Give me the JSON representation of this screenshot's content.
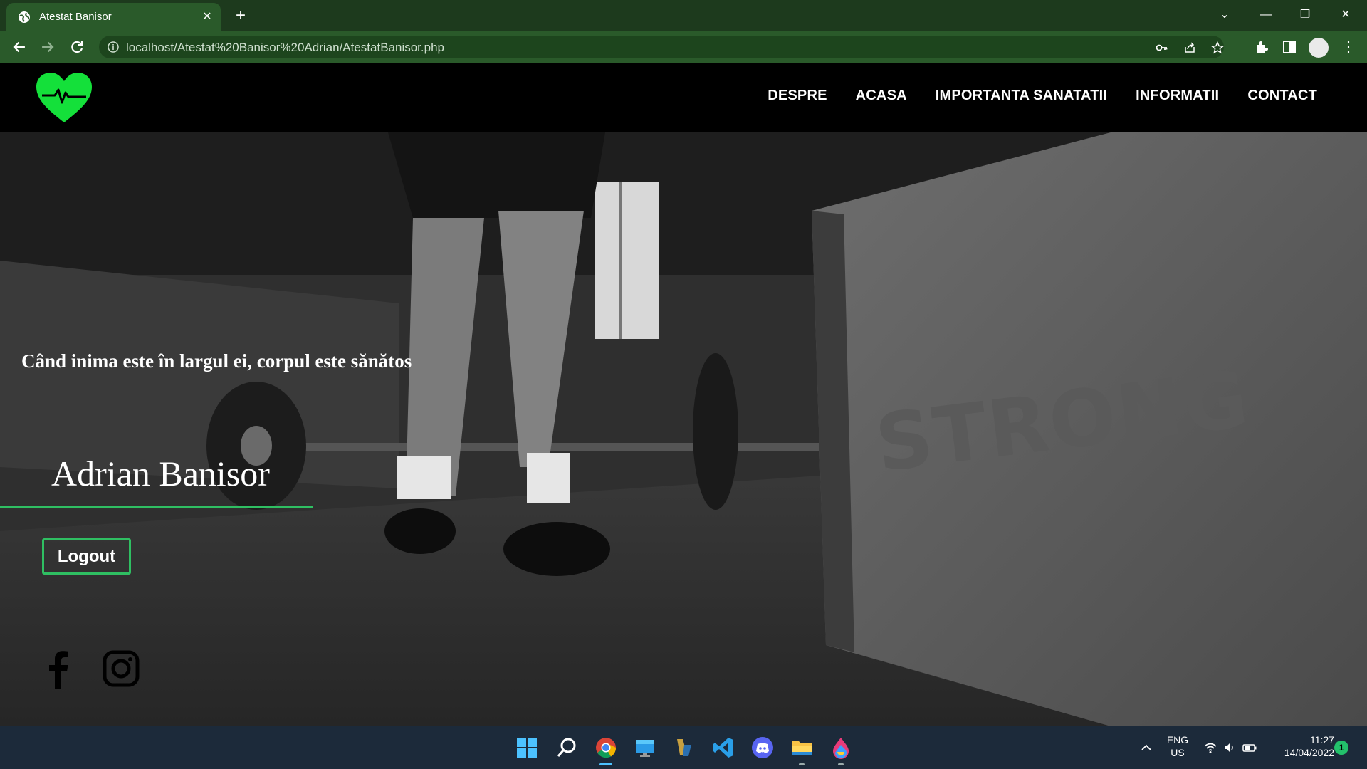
{
  "browser": {
    "tab_title": "Atestat Banisor",
    "url": "localhost/Atestat%20Banisor%20Adrian/AtestatBanisor.php",
    "icons": [
      "globe-icon",
      "close-icon",
      "plus-icon",
      "chevron-down-icon",
      "minimize-icon",
      "restore-icon",
      "window-close-icon",
      "back-icon",
      "forward-icon",
      "reload-icon",
      "info-icon",
      "key-icon",
      "share-icon",
      "star-icon",
      "extensions-icon",
      "side-panel-icon",
      "profile-avatar",
      "menu-icon"
    ]
  },
  "site": {
    "nav": [
      "DESPRE",
      "ACASA",
      "IMPORTANTA SANATATII",
      "INFORMATII",
      "CONTACT"
    ],
    "quote": "Când inima este în largul ei, corpul este sănătos",
    "user_name": "Adrian Banisor",
    "logout_label": "Logout",
    "hero_box_text": "STRONG",
    "accent_color": "#2fbf62",
    "logo_color": "#14e03a",
    "social_icons": [
      "facebook-icon",
      "instagram-icon"
    ]
  },
  "taskbar": {
    "apps": [
      "windows-start-icon",
      "search-icon",
      "chrome-icon",
      "desktop-icon",
      "app-icon",
      "vscode-icon",
      "discord-icon",
      "file-explorer-icon",
      "paint-icon"
    ],
    "lang_line1": "ENG",
    "lang_line2": "US",
    "time": "11:27",
    "date": "14/04/2022",
    "notification_count": "1"
  }
}
